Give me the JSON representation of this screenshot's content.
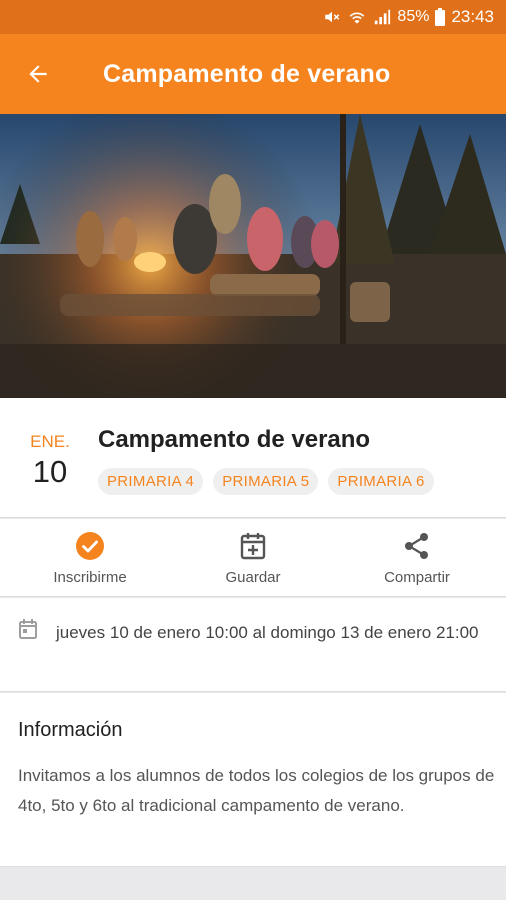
{
  "status_bar": {
    "battery": "85%",
    "time": "23:43"
  },
  "app_bar": {
    "title": "Campamento de verano",
    "back_icon": "arrow-back-icon"
  },
  "hero": {
    "image": "campfire-photo"
  },
  "event": {
    "month": "ENE.",
    "day": "10",
    "title": "Campamento de verano",
    "tags": [
      "PRIMARIA 4",
      "PRIMARIA 5",
      "PRIMARIA 6"
    ]
  },
  "actions": [
    {
      "label": "Inscribirme",
      "icon": "check-circle-icon"
    },
    {
      "label": "Guardar",
      "icon": "calendar-add-icon"
    },
    {
      "label": "Compartir",
      "icon": "share-icon"
    }
  ],
  "schedule": {
    "text": "jueves 10 de enero 10:00 al domingo 13 de enero 21:00",
    "icon": "calendar-icon"
  },
  "info": {
    "title": "Información",
    "body": "Invitamos a los alumnos de todos los colegios de los grupos de 4to, 5to y 6to al tradicional campamento de verano."
  },
  "colors": {
    "primary": "#f5841f",
    "status": "#e0711a"
  }
}
